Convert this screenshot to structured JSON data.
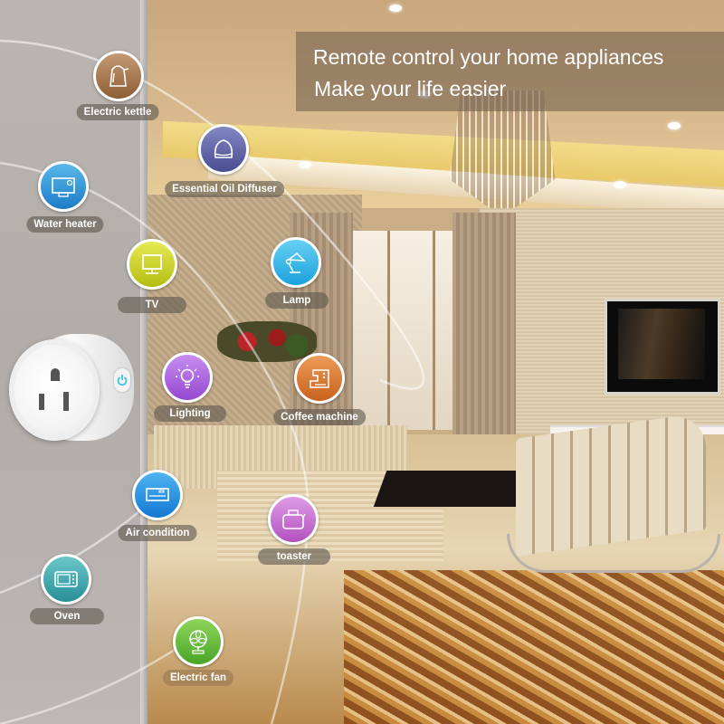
{
  "headline": {
    "line1": "Remote control your home appliances",
    "line2": "Make your life easier"
  },
  "product": {
    "name": "smart-plug",
    "power_button_icon": "power-icon",
    "indicator_color": "#3fc2e6"
  },
  "appliances": [
    {
      "id": "electric-kettle",
      "label": "Electric kettle",
      "icon": "kettle-icon",
      "color": "#a7764a"
    },
    {
      "id": "essential-oil-diffuser",
      "label": "Essential Oil Diffuser",
      "icon": "diffuser-icon",
      "color": "#5f63a6"
    },
    {
      "id": "water-heater",
      "label": "Water heater",
      "icon": "water-heater-icon",
      "color": "#2b93d6"
    },
    {
      "id": "tv",
      "label": "TV",
      "icon": "tv-icon",
      "color": "#c7cf1c"
    },
    {
      "id": "lamp",
      "label": "Lamp",
      "icon": "lamp-icon",
      "color": "#2fb6e8"
    },
    {
      "id": "lighting",
      "label": "Lighting",
      "icon": "lightbulb-icon",
      "color": "#a659d8"
    },
    {
      "id": "coffee-machine",
      "label": "Coffee machine",
      "icon": "coffee-machine-icon",
      "color": "#d9772d"
    },
    {
      "id": "air-condition",
      "label": "Air condition",
      "icon": "air-conditioner-icon",
      "color": "#1e8fe0"
    },
    {
      "id": "toaster",
      "label": "toaster",
      "icon": "toaster-icon",
      "color": "#c268cc"
    },
    {
      "id": "oven",
      "label": "Oven",
      "icon": "microwave-oven-icon",
      "color": "#33a3a8"
    },
    {
      "id": "electric-fan",
      "label": "Electric fan",
      "icon": "fan-icon",
      "color": "#5cb834"
    }
  ]
}
